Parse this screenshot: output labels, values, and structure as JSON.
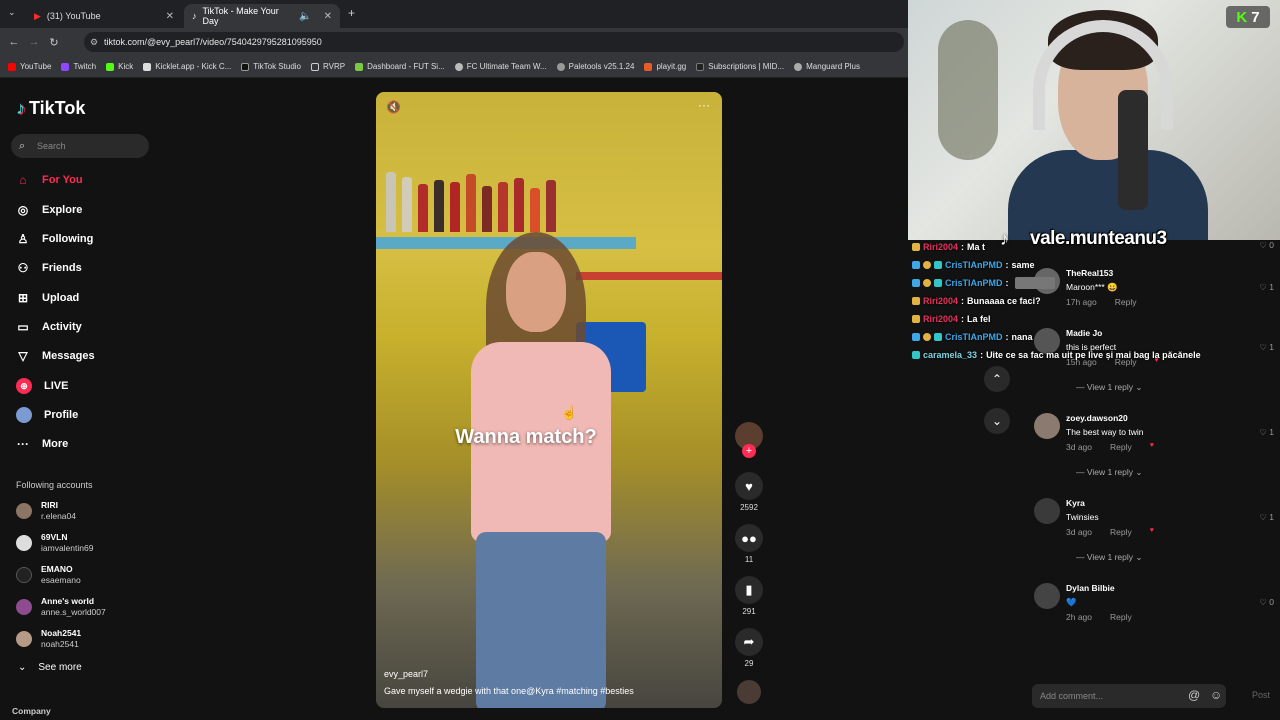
{
  "browser": {
    "tabs": [
      {
        "label": "(31) YouTube",
        "active": false
      },
      {
        "label": "TikTok - Make Your Day",
        "active": true
      }
    ],
    "url": "tiktok.com/@evy_pearl7/video/7540429795281095950",
    "bookmarks": [
      "YouTube",
      "Twitch",
      "Kick",
      "Kicklet.app - Kick C...",
      "TikTok Studio",
      "RVRP",
      "Dashboard - FUT Si...",
      "FC Ultimate Team W...",
      "Paletools v25.1.24",
      "playit.gg",
      "Subscriptions | MID...",
      "Manguard Plus"
    ]
  },
  "tiktok": {
    "logo": "TikTok",
    "search_placeholder": "Search",
    "nav": [
      {
        "label": "For You",
        "icon": "home-icon",
        "active": true
      },
      {
        "label": "Explore",
        "icon": "compass-icon"
      },
      {
        "label": "Following",
        "icon": "following-icon"
      },
      {
        "label": "Friends",
        "icon": "friends-icon"
      },
      {
        "label": "Upload",
        "icon": "upload-icon"
      },
      {
        "label": "Activity",
        "icon": "activity-icon"
      },
      {
        "label": "Messages",
        "icon": "messages-icon"
      },
      {
        "label": "LIVE",
        "icon": "live-icon"
      },
      {
        "label": "Profile",
        "icon": "profile-icon"
      },
      {
        "label": "More",
        "icon": "more-icon"
      }
    ],
    "following_title": "Following accounts",
    "following_accounts": [
      {
        "name": "RIRI",
        "handle": "r.elena04"
      },
      {
        "name": "69VLN",
        "handle": "iamvalentin69"
      },
      {
        "name": "EMANO",
        "handle": "esaemano"
      },
      {
        "name": "Anne's world",
        "handle": "anne.s_world007"
      },
      {
        "name": "Noah2541",
        "handle": "noah2541"
      }
    ],
    "see_more": "See more",
    "company": "Company"
  },
  "video": {
    "overlay_text": "Wanna match?",
    "username": "evy_pearl7",
    "caption": "Gave myself a wedgie with that one@Kyra  #matching  #besties",
    "likes": "2592",
    "comments": "11",
    "saves": "291",
    "shares": "29"
  },
  "comments": [
    {
      "user": "TheReal153",
      "text": "Maroon*** 😀",
      "time": "17h ago",
      "reply": "Reply",
      "likes": "1"
    },
    {
      "user": "Madie Jo",
      "text": "this is perfect",
      "time": "15h ago",
      "reply": "Reply",
      "likes": "1",
      "view_replies": "View 1 reply"
    },
    {
      "user": "zoey.dawson20",
      "text": "The best way to twin",
      "time": "3d ago",
      "reply": "Reply",
      "likes": "1",
      "view_replies": "View 1 reply"
    },
    {
      "user": "Kyra",
      "text": "Twinsies",
      "time": "3d ago",
      "reply": "Reply",
      "likes": "1",
      "view_replies": "View 1 reply"
    },
    {
      "user": "Dylan Bilbie",
      "text": "💙",
      "time": "2h ago",
      "reply": "Reply",
      "likes": "0"
    }
  ],
  "top_comment_like": "0",
  "add_comment_placeholder": "Add comment...",
  "post_label": "Post",
  "stream": {
    "channel_name": "vale.munteanu3",
    "kick_count": "7",
    "chat": [
      {
        "user": "Riri2004",
        "msg": "Ma t",
        "color": "#e8325d"
      },
      {
        "user": "CrisTIAnPMD",
        "msg": "same",
        "color": "#3ea7e8"
      },
      {
        "user": "CrisTIAnPMD",
        "msg": "",
        "color": "#3ea7e8"
      },
      {
        "user": "Riri2004",
        "msg": "Bunaaaa ce faci?",
        "color": "#e8325d"
      },
      {
        "user": "Riri2004",
        "msg": "La fel",
        "color": "#e8325d"
      },
      {
        "user": "CrisTIAnPMD",
        "msg": "nana",
        "color": "#3ea7e8"
      },
      {
        "user": "caramela_33",
        "msg": "Uite ce sa fac ma uit pe live și mai bag la păcănele",
        "color": "#7fd3e0"
      }
    ]
  }
}
